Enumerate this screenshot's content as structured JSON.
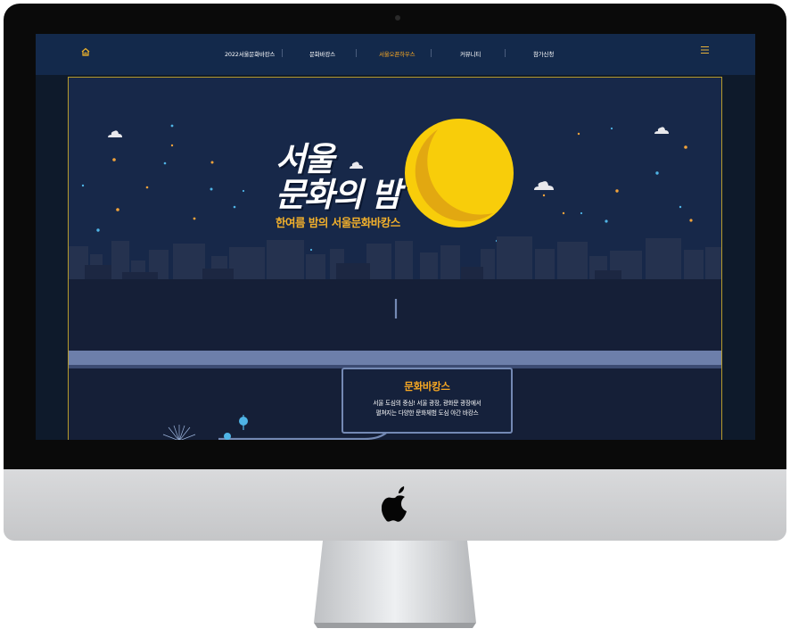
{
  "nav": {
    "items": [
      {
        "label": "2022서울문화바캉스",
        "active": false
      },
      {
        "label": "문화바캉스",
        "active": false
      },
      {
        "label": "서울오픈하우스",
        "active": true
      },
      {
        "label": "커뮤니티",
        "active": false
      },
      {
        "label": "참가신청",
        "active": false
      }
    ],
    "home_icon": "home-icon",
    "menu_icon": "hamburger-menu-icon",
    "active_color": "#f7a823"
  },
  "hero": {
    "title_line1": "서울",
    "title_line2": "문화의 밤",
    "subtitle": "한여름 밤의 서울문화바캉스",
    "moon_color": "#f6c90e"
  },
  "info": {
    "title": "문화바캉스",
    "line1": "서울 도심의 중심! 서울 광장, 광화문 광장에서",
    "line2": "펼쳐지는 다양한 문화체험 도심 야간 바캉스"
  },
  "colors": {
    "frame_border": "#b59a2b",
    "nav_bg": "#13294b",
    "sky": "#172849",
    "accent": "#f7a823"
  }
}
